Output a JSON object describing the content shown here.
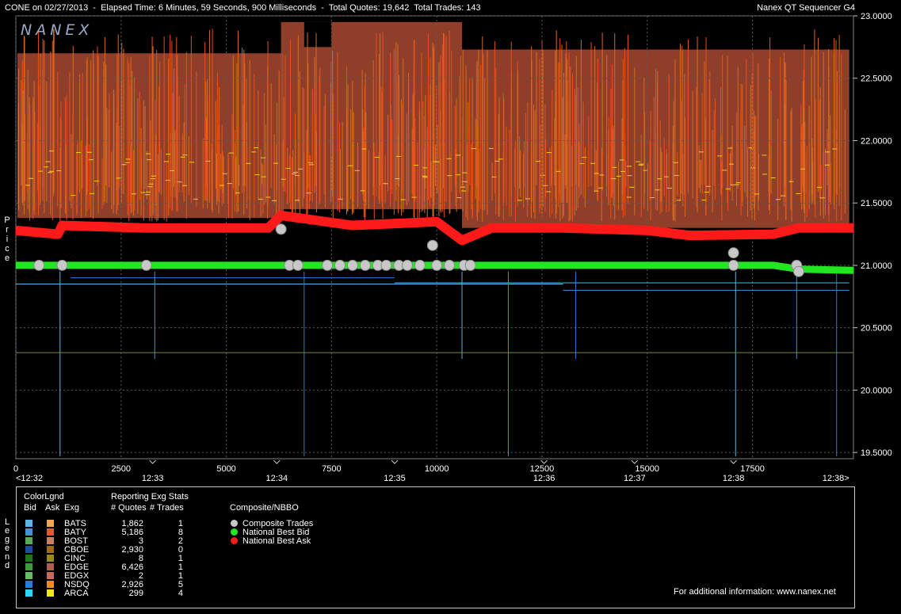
{
  "header": {
    "left": "CONE on 02/27/2013  -  Elapsed Time: 6 Minutes, 59 Seconds, 900 Milliseconds  -  Total Quotes: 19,642  Total Trades: 143",
    "right": "Nanex QT Sequencer G4"
  },
  "watermark": "NANEX",
  "y_axis_label": [
    "P",
    "r",
    "i",
    "c",
    "e"
  ],
  "legend_side_label": [
    "L",
    "e",
    "g",
    "e",
    "n",
    "d"
  ],
  "chart_data": {
    "type": "line",
    "ylim": [
      19.45,
      23.0
    ],
    "xlim": [
      0,
      19900
    ],
    "y_ticks": [
      "23.0000",
      "22.5000",
      "22.0000",
      "21.5000",
      "21.0000",
      "20.5000",
      "20.0000",
      "19.5000"
    ],
    "y_tick_values": [
      23.0,
      22.5,
      22.0,
      21.5,
      21.0,
      20.5,
      20.0,
      19.5
    ],
    "x_ticks": [
      "0",
      "2500",
      "5000",
      "7500",
      "10000",
      "12500",
      "15000",
      "17500"
    ],
    "x_tick_values": [
      0,
      2500,
      5000,
      7500,
      10000,
      12500,
      15000,
      17500
    ],
    "time_labels": [
      "<12:32",
      "12:33",
      "12:34",
      "12:35",
      "12:36",
      "12:37",
      "12:38",
      "12:38>"
    ],
    "time_values": [
      0,
      3250,
      6200,
      9000,
      12550,
      14700,
      17050,
      19800
    ],
    "grid": true,
    "series": [
      {
        "name": "National Best Bid",
        "color": "#22e622",
        "x": [
          0,
          3000,
          6000,
          9000,
          12000,
          15000,
          18000,
          18600,
          19900
        ],
        "y": [
          21.0,
          21.0,
          21.0,
          21.0,
          21.0,
          21.0,
          21.0,
          20.97,
          20.96
        ]
      },
      {
        "name": "National Best Ask",
        "color": "#ff1a1a",
        "x": [
          0,
          1000,
          1100,
          3000,
          6000,
          6300,
          8000,
          10000,
          10600,
          11300,
          13000,
          15000,
          16000,
          18000,
          18600,
          19900
        ],
        "y": [
          21.28,
          21.25,
          21.32,
          21.3,
          21.3,
          21.4,
          21.32,
          21.35,
          21.2,
          21.3,
          21.3,
          21.28,
          21.24,
          21.25,
          21.3,
          21.3
        ]
      },
      {
        "name": "Composite Trades",
        "color": "#c8c8c8",
        "x": [
          550,
          1100,
          3100,
          6300,
          6500,
          6700,
          7400,
          7700,
          8000,
          8300,
          8600,
          8800,
          9100,
          9300,
          9600,
          9900,
          10000,
          10300,
          10650,
          10800,
          17050,
          17050,
          18550,
          18600
        ],
        "y": [
          21.0,
          21.0,
          21.0,
          21.29,
          21.0,
          21.0,
          21.0,
          21.0,
          21.0,
          21.0,
          21.0,
          21.0,
          21.0,
          21.0,
          21.0,
          21.16,
          21.0,
          21.0,
          21.0,
          21.0,
          21.1,
          21.0,
          21.0,
          20.95
        ]
      }
    ]
  },
  "legend": {
    "col_colorlgnd": "ColorLgnd",
    "col_bid": "Bid",
    "col_ask": "Ask",
    "col_exg": "Exg",
    "col_reporting": "Reporting Exg Stats",
    "col_quotes": "# Quotes",
    "col_trades": "# Trades",
    "col_composite": "Composite/NBBO",
    "rows": [
      {
        "exg": "BATS",
        "quotes": "1,862",
        "trades": "1",
        "bid": "#5ab4e6",
        "ask": "#f5a54a"
      },
      {
        "exg": "BATY",
        "quotes": "5,186",
        "trades": "8",
        "bid": "#4a90d0",
        "ask": "#e8582a"
      },
      {
        "exg": "BOST",
        "quotes": "3",
        "trades": "2",
        "bid": "#5aa85a",
        "ask": "#c88060"
      },
      {
        "exg": "CBOE",
        "quotes": "2,930",
        "trades": "0",
        "bid": "#1c4c9c",
        "ask": "#a06a1a"
      },
      {
        "exg": "CINC",
        "quotes": "8",
        "trades": "1",
        "bid": "#1a7a1a",
        "ask": "#9a8a1a"
      },
      {
        "exg": "EDGE",
        "quotes": "6,426",
        "trades": "1",
        "bid": "#3c9c3c",
        "ask": "#b0604a"
      },
      {
        "exg": "EDGX",
        "quotes": "2",
        "trades": "1",
        "bid": "#6ab86a",
        "ask": "#c86a5a"
      },
      {
        "exg": "NSDQ",
        "quotes": "2,926",
        "trades": "5",
        "bid": "#2a7ae0",
        "ask": "#f08c1a"
      },
      {
        "exg": "ARCA",
        "quotes": "299",
        "trades": "4",
        "bid": "#28d8f0",
        "ask": "#f0e81a"
      }
    ],
    "nbbo": [
      {
        "label": "Composite Trades",
        "color": "#c8c8c8"
      },
      {
        "label": "National Best Bid",
        "color": "#22e622"
      },
      {
        "label": "National Best Ask",
        "color": "#ff1a1a"
      }
    ],
    "footer": "For additional information: www.nanex.net"
  }
}
